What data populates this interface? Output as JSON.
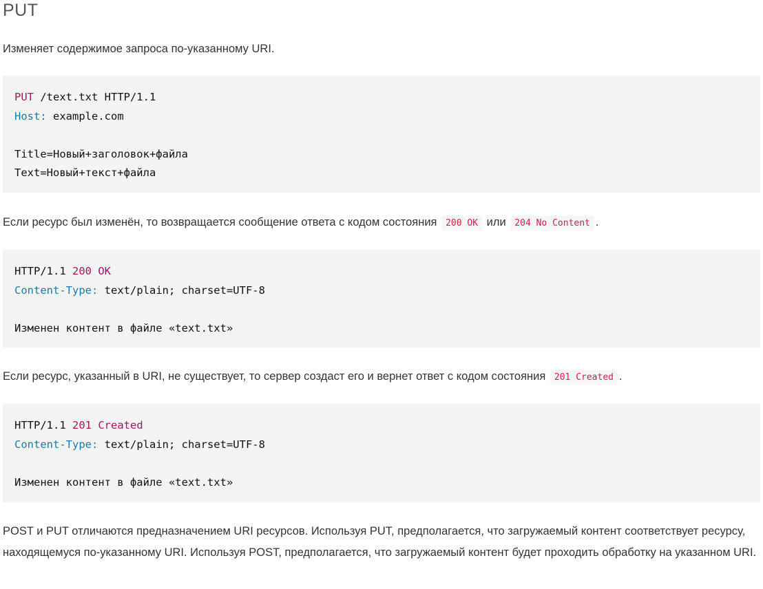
{
  "heading": "PUT",
  "intro": "Изменяет содержимое запроса по-указанному URI.",
  "request_block": {
    "line1_method": "PUT",
    "line1_rest": " /text.txt HTTP/1.1",
    "line2_header": "Host:",
    "line2_value": " example.com",
    "line4": "Title=Новый+заголовок+файла",
    "line5": "Text=Новый+текст+файла"
  },
  "para_modified": {
    "text_before": "Если ресурс был изменён, то возвращается сообщение ответа с кодом состояния",
    "code1": "200 OK",
    "text_middle": "или",
    "code2": "204 No Content",
    "text_after": "."
  },
  "response_ok_block": {
    "line1_proto": "HTTP/1.1 ",
    "line1_status": "200 OK",
    "line2_header": "Content-Type:",
    "line2_value": " text/plain; charset=UTF-8",
    "line4": "Изменен контент в файле «text.txt»"
  },
  "para_created": {
    "text_before": "Если ресурс, указанный в URI, не существует, то сервер создаст его и вернет ответ с кодом состояния",
    "code1": "201 Created",
    "text_after": "."
  },
  "response_created_block": {
    "line1_proto": "HTTP/1.1 ",
    "line1_status": "201 Created",
    "line2_header": "Content-Type:",
    "line2_value": " text/plain; charset=UTF-8",
    "line4": "Изменен контент в файле «text.txt»"
  },
  "para_diff": "POST и PUT отличаются предназначением URI ресурсов. Используя PUT, предполагается, что загружаемый контент соответствует ресурсу, находящемуся по-указанному URI. Используя POST, предполагается, что загружаемый контент будет проходить обработку на указанном URI.",
  "colors": {
    "method": "#9a1a5e",
    "header": "#22789e",
    "inline_code": "#c7254e",
    "code_bg": "#f4f4f4"
  }
}
